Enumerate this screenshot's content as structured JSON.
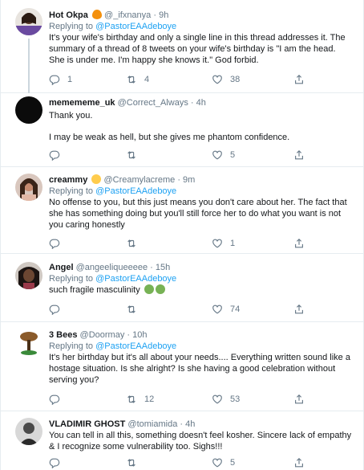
{
  "tweets": [
    {
      "name": "Hot Okpa",
      "name_emoji": "fire",
      "handle": "@_ifxnanya",
      "time": "9h",
      "replying_prefix": "Replying to",
      "replying_to": "@PastorEAAdeboye",
      "text": "It's your wife's birthday and only a single line in this thread addresses it. The summary of a thread of 8 tweets on your wife's birthday is \"I am the head. She is under me. I'm happy she knows it.\" God forbid.",
      "replies": "1",
      "retweets": "4",
      "likes": "38"
    },
    {
      "name": "memememe_uk",
      "handle": "@Correct_Always",
      "time": "4h",
      "text": "Thank you.",
      "text2": "I may be weak as hell, but she gives me phantom confidence.",
      "replies": "",
      "retweets": "",
      "likes": "5"
    },
    {
      "name": "creammy",
      "name_emoji": "slightly-smiling-face",
      "handle": "@Creamylacreme",
      "time": "9m",
      "replying_prefix": "Replying to",
      "replying_to": "@PastorEAAdeboye",
      "text": "No offense to you, but this just means you don't care about her. The fact that she has something doing but you'll still force her to do what you want is not you caring honestly",
      "replies": "",
      "retweets": "",
      "likes": "1"
    },
    {
      "name": "Angel",
      "handle": "@angeeliqueeeee",
      "time": "15h",
      "replying_prefix": "Replying to",
      "replying_to": "@PastorEAAdeboye",
      "text": "such fragile masculinity",
      "text_emoji": "nauseated-face x2",
      "replies": "",
      "retweets": "",
      "likes": "74"
    },
    {
      "name": "3 Bees",
      "handle": "@Doormay",
      "time": "10h",
      "replying_prefix": "Replying to",
      "replying_to": "@PastorEAAdeboye",
      "text": "It's her birthday but it's all about your needs.... Everything written sound like a hostage situation. Is she alright? Is she having a good celebration without serving you?",
      "replies": "",
      "retweets": "12",
      "likes": "53"
    },
    {
      "name": "VLADIMIR GHOST",
      "handle": "@tomiamida",
      "time": "4h",
      "text": "You can tell in all this, something doesn't feel kosher. Sincere lack of empathy & I recognize some vulnerability too. Sighs!!!",
      "replies": "",
      "retweets": "",
      "likes": "5"
    }
  ],
  "separator": "·",
  "colors": {
    "link": "#1da1f2",
    "muted": "#657786",
    "border": "#e6ecf0",
    "thread_line": "#ccd6dd"
  },
  "icons": {
    "reply": "reply-icon",
    "retweet": "retweet-icon",
    "like": "heart-icon",
    "share": "share-icon"
  }
}
